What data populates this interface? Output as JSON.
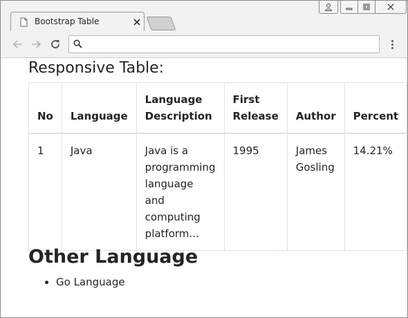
{
  "browser": {
    "tab_title": "Bootstrap Table",
    "address_value": ""
  },
  "page": {
    "heading": "Responsive Table:",
    "table": {
      "headers": [
        "No",
        "Language",
        "Language Description",
        "First Release",
        "Author",
        "Percent"
      ],
      "rows": [
        [
          "1",
          "Java",
          "Java is a programming language and computing platform...",
          "1995",
          "James Gosling",
          "14.21%"
        ]
      ]
    },
    "other_heading": "Other Language",
    "other_list": [
      "Go Language"
    ]
  },
  "icons": {
    "profile": "person-icon",
    "minimize": "minimize-icon",
    "maximize": "maximize-icon",
    "close": "close-icon",
    "tab_page": "page-icon",
    "back": "arrow-left-icon",
    "forward": "arrow-right-icon",
    "reload": "reload-icon",
    "search": "search-icon",
    "menu": "kebab-menu-icon"
  }
}
